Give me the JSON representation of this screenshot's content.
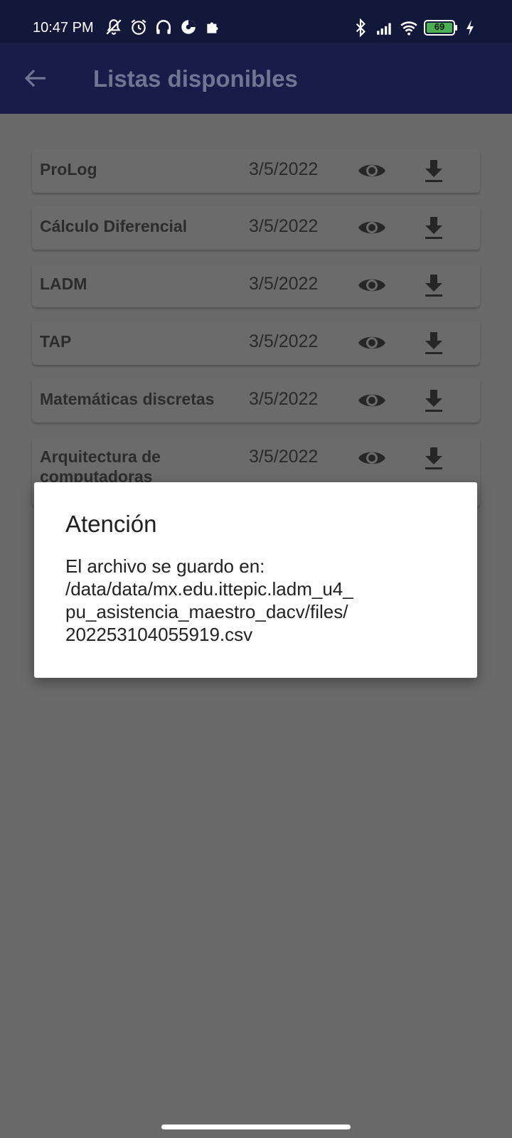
{
  "status_bar": {
    "time": "10:47 PM",
    "battery_level": "69",
    "icons_left": [
      "mute-bell-icon",
      "alarm-icon",
      "headset-icon",
      "pie-chart-icon",
      "puzzle-icon"
    ],
    "icons_right": [
      "bluetooth-icon",
      "signal-icon",
      "wifi-icon",
      "battery-icon",
      "charging-icon"
    ]
  },
  "app_bar": {
    "title": "Listas disponibles",
    "back_icon": "arrow-left-icon",
    "background_color": "#171d48"
  },
  "lists": [
    {
      "name": "ProLog",
      "date": "3/5/2022"
    },
    {
      "name": "Cálculo Diferencial",
      "date": "3/5/2022"
    },
    {
      "name": "LADM",
      "date": "3/5/2022"
    },
    {
      "name": "TAP",
      "date": "3/5/2022"
    },
    {
      "name": "Matemáticas discretas",
      "date": "3/5/2022"
    },
    {
      "name": "Arquitectura de computadoras",
      "date": "3/5/2022"
    }
  ],
  "dialog": {
    "title": "Atención",
    "message_lines": [
      "El archivo se guardo en:",
      "/data/data/mx.edu.ittepic.ladm_u4_",
      "pu_asistencia_maestro_dacv/files/",
      "202253104055919.csv"
    ]
  },
  "colors": {
    "status_bar": "#111839",
    "scrim": "#6a6a6a",
    "dialog_background": "#ffffff",
    "battery_fill": "#4caf50"
  }
}
